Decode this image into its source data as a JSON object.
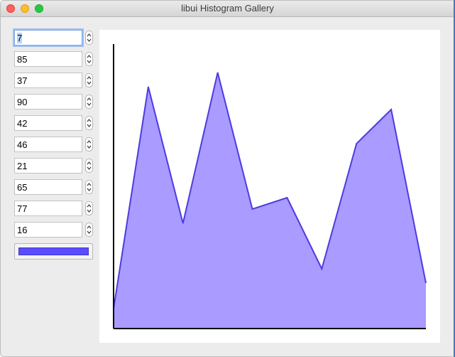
{
  "window": {
    "title": "libui Histogram Gallery"
  },
  "values": [
    "7",
    "85",
    "37",
    "90",
    "42",
    "46",
    "21",
    "65",
    "77",
    "16"
  ],
  "color_button": {
    "color": "#5b4dff"
  },
  "chart_data": {
    "type": "area",
    "x": [
      0,
      1,
      2,
      3,
      4,
      5,
      6,
      7,
      8,
      9
    ],
    "values": [
      7,
      85,
      37,
      90,
      42,
      46,
      21,
      65,
      77,
      16
    ],
    "ylim": [
      0,
      100
    ],
    "title": "",
    "xlabel": "",
    "ylabel": "",
    "line_color": "#4b3ce0",
    "fill_color": "#a99bff",
    "axis_color": "#000000"
  }
}
